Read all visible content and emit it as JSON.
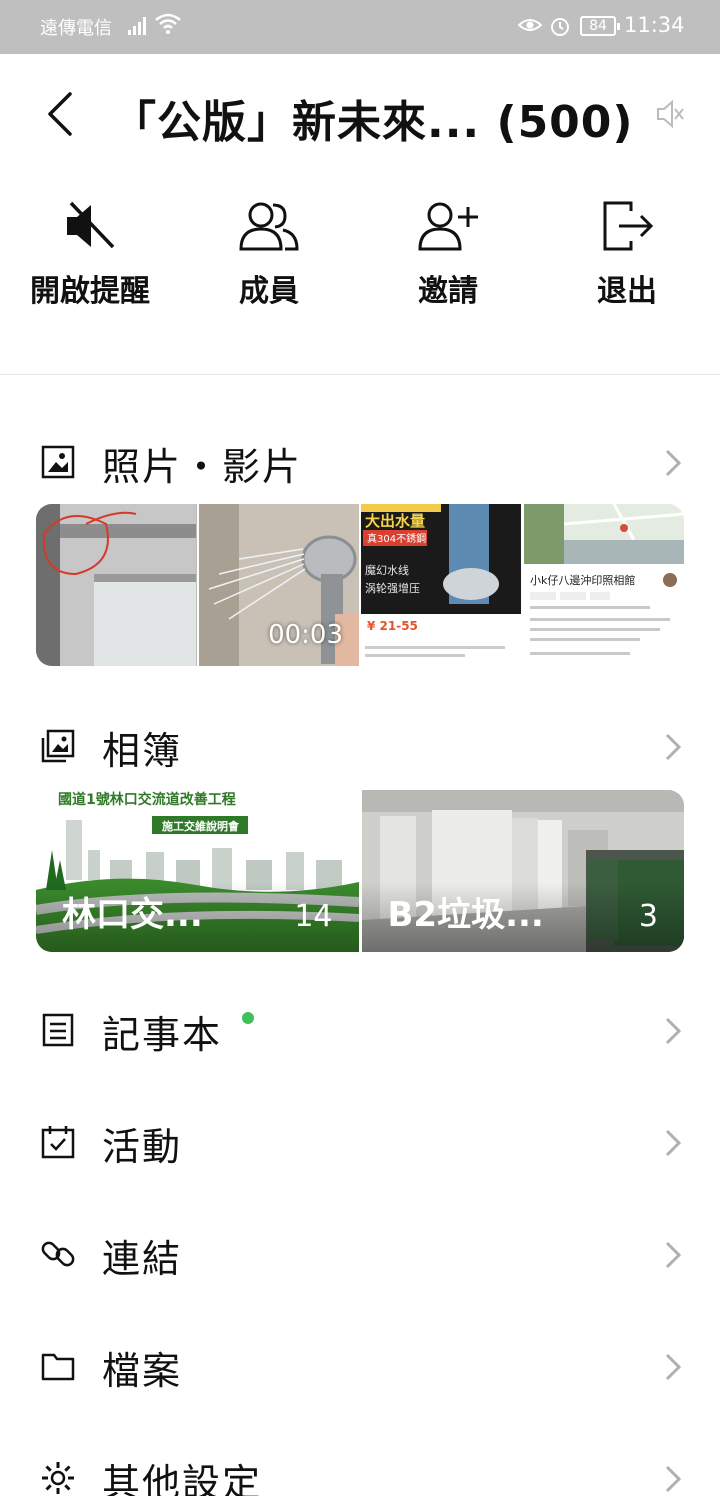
{
  "status_bar": {
    "carrier": "遠傳電信",
    "battery": "84",
    "time": "11:34",
    "icons": [
      "signal-icon",
      "wifi-icon",
      "eye-icon",
      "alarm-icon",
      "battery-icon"
    ]
  },
  "header": {
    "title": "「公版」新未來...  (500)"
  },
  "actions": [
    {
      "label": "開啟提醒",
      "icon": "muted-bell-icon"
    },
    {
      "label": "成員",
      "icon": "members-icon"
    },
    {
      "label": "邀請",
      "icon": "add-person-icon"
    },
    {
      "label": "退出",
      "icon": "exit-icon"
    }
  ],
  "sections": {
    "photos": {
      "label": "照片・影片",
      "video_duration": "00:03"
    },
    "albums": {
      "label": "相簿",
      "items": [
        {
          "name": "林口交...",
          "count": "14"
        },
        {
          "name": "B2垃圾...",
          "count": "3"
        }
      ]
    },
    "notes": {
      "label": "記事本"
    },
    "events": {
      "label": "活動"
    },
    "links": {
      "label": "連結"
    },
    "files": {
      "label": "檔案"
    },
    "settings": {
      "label": "其他設定"
    }
  },
  "thumbnail_text": {
    "shower_ad": {
      "line1": "大出水量",
      "line2": "真304不銹鋼",
      "line3": "魔幻水线",
      "line4": "涡轮强增压",
      "price": "¥ 21-55"
    },
    "map_card": {
      "place": "小k仔八邊沖印照相館"
    },
    "construction_album": {
      "line1": "國道1號林口交流道改善工程",
      "line2": "施工交維說明會"
    }
  },
  "colors": {
    "accent_green": "#3ec25a",
    "status_bar": "#bfbfbf"
  }
}
